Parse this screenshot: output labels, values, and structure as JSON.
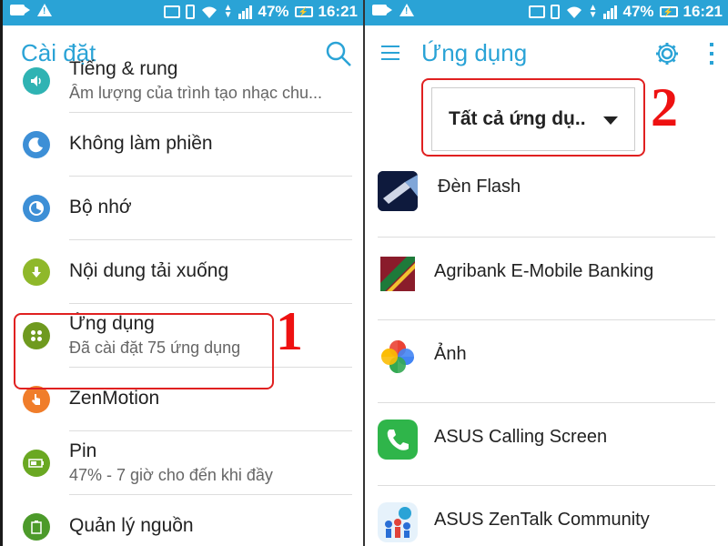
{
  "status_bar": {
    "battery_percent": "47%",
    "time": "16:21"
  },
  "left": {
    "title": "Cài đặt",
    "items": [
      {
        "title": "Tiếng & rung",
        "subtitle": "Âm lượng của trình tạo nhạc chu...",
        "icon": "volume-icon",
        "color": "#2fb3b3"
      },
      {
        "title": "Không làm phiền",
        "subtitle": "",
        "icon": "moon-icon",
        "color": "#3d8fd6"
      },
      {
        "title": "Bộ nhớ",
        "subtitle": "",
        "icon": "storage-icon",
        "color": "#3d8fd6"
      },
      {
        "title": "Nội dung tải xuống",
        "subtitle": "",
        "icon": "download-icon",
        "color": "#8fb82a"
      },
      {
        "title": "Ứng dụng",
        "subtitle": "Đã cài đặt 75 ứng dụng",
        "icon": "apps-icon",
        "color": "#6f9a1f"
      },
      {
        "title": "ZenMotion",
        "subtitle": "",
        "icon": "touch-icon",
        "color": "#f07d2a"
      },
      {
        "title": "Pin",
        "subtitle": "47% - 7 giờ cho đến khi đầy",
        "icon": "battery-icon",
        "color": "#6aa822"
      },
      {
        "title": "Quản lý nguồn",
        "subtitle": "",
        "icon": "power-manager-icon",
        "color": "#4c9a2a"
      }
    ],
    "step_label": "1"
  },
  "right": {
    "title": "Ứng dụng",
    "filter_value": "Tất cả ứng dụ..",
    "step_label": "2",
    "apps": [
      {
        "name": "Đèn Flash",
        "icon": "flashlight-app-icon"
      },
      {
        "name": "Agribank E-Mobile Banking",
        "icon": "agribank-app-icon"
      },
      {
        "name": "Ảnh",
        "icon": "photos-app-icon"
      },
      {
        "name": "ASUS Calling Screen",
        "icon": "calling-screen-app-icon"
      },
      {
        "name": "ASUS ZenTalk Community",
        "icon": "zentalk-app-icon"
      }
    ]
  },
  "colors": {
    "accent": "#2aa3d6",
    "highlight": "#e02020"
  }
}
